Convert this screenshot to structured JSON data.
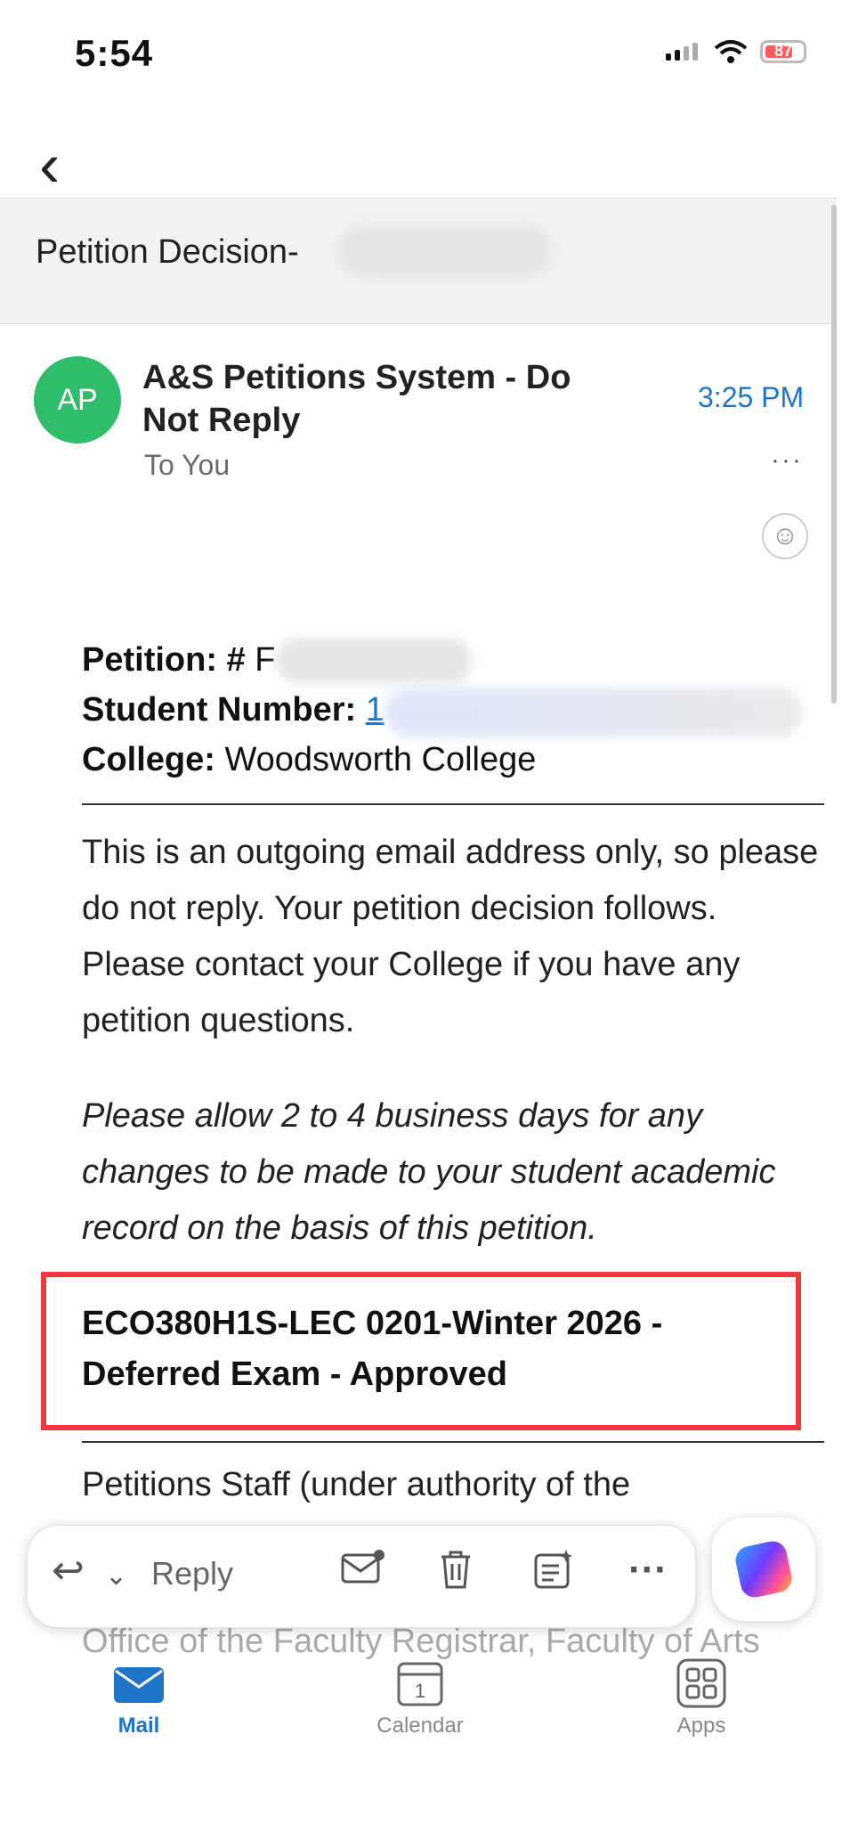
{
  "status_bar": {
    "time": "5:54",
    "battery_level": "87"
  },
  "subject": "Petition Decision-",
  "sender": {
    "initials": "AP",
    "name": "A&S Petitions System - Do Not Reply",
    "time": "3:25 PM",
    "to": "To You"
  },
  "body": {
    "petition_label": "Petition: #",
    "petition_value": "F",
    "student_label": "Student Number:",
    "student_value": "1",
    "college_label": "College:",
    "college_value": "Woodsworth College",
    "paragraph1": "This is an outgoing email address only, so please do not reply. Your petition decision follows. Please contact your College if you have any petition questions.",
    "paragraph2": "Please allow 2 to 4 business days for any changes to be made to your student academic record on the basis of this petition.",
    "highlight": "ECO380H1S-LEC 0201-Winter 2026 - Deferred Exam - Approved",
    "paragraph3": "Petitions Staff (under authority of the",
    "paragraph4": "Office of the Faculty Registrar, Faculty of Arts"
  },
  "toolbar": {
    "reply_label": "Reply"
  },
  "tabs": [
    {
      "label": "Mail"
    },
    {
      "label": "Calendar"
    },
    {
      "label": "Apps"
    }
  ],
  "icons": [
    "back-chevron-icon",
    "reply-icon",
    "mail-unread-icon",
    "trash-icon",
    "summary-icon",
    "more-icon",
    "copilot-icon",
    "mail-icon",
    "calendar-icon",
    "apps-icon",
    "react-emoji-icon",
    "signal-icon",
    "wifi-icon",
    "battery-icon"
  ],
  "colors": {
    "accent": "#1e75c8",
    "avatar": "#2fbd6c",
    "highlight_border": "#e8393d"
  }
}
